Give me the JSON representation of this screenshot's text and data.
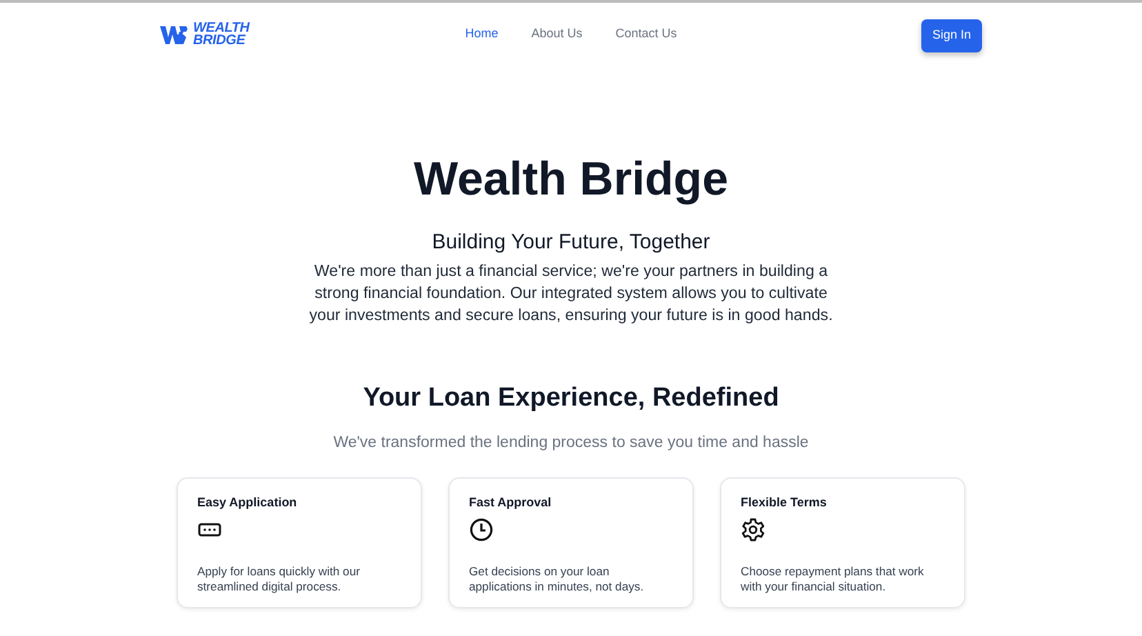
{
  "logo": {
    "line_1": "WEALTH",
    "line_2": "BRIDGE"
  },
  "nav": [
    {
      "label": "Home",
      "selected": true
    },
    {
      "label": "About Us",
      "selected": false
    },
    {
      "label": "Contact Us",
      "selected": false
    }
  ],
  "sign_in": "Sign In",
  "hero": {
    "title": "Wealth Bridge",
    "subtitle": "Building Your Future, Together",
    "text": "We're more than just a financial service; we're your partners in building a strong financial foundation. Our integrated system allows you to cultivate your investments and secure loans, ensuring your future is in good hands."
  },
  "section": {
    "title": "Your Loan Experience, Redefined",
    "subtitle": "We've transformed the lending process to save you time and hassle"
  },
  "features": [
    {
      "title": "Easy Application",
      "text": "Apply for loans quickly with our streamlined digital process."
    },
    {
      "title": "Fast Approval",
      "text": "Get decisions on your loan applications in minutes, not days."
    },
    {
      "title": "Flexible Terms",
      "text": "Choose repayment plans that work with your financial situation."
    }
  ]
}
